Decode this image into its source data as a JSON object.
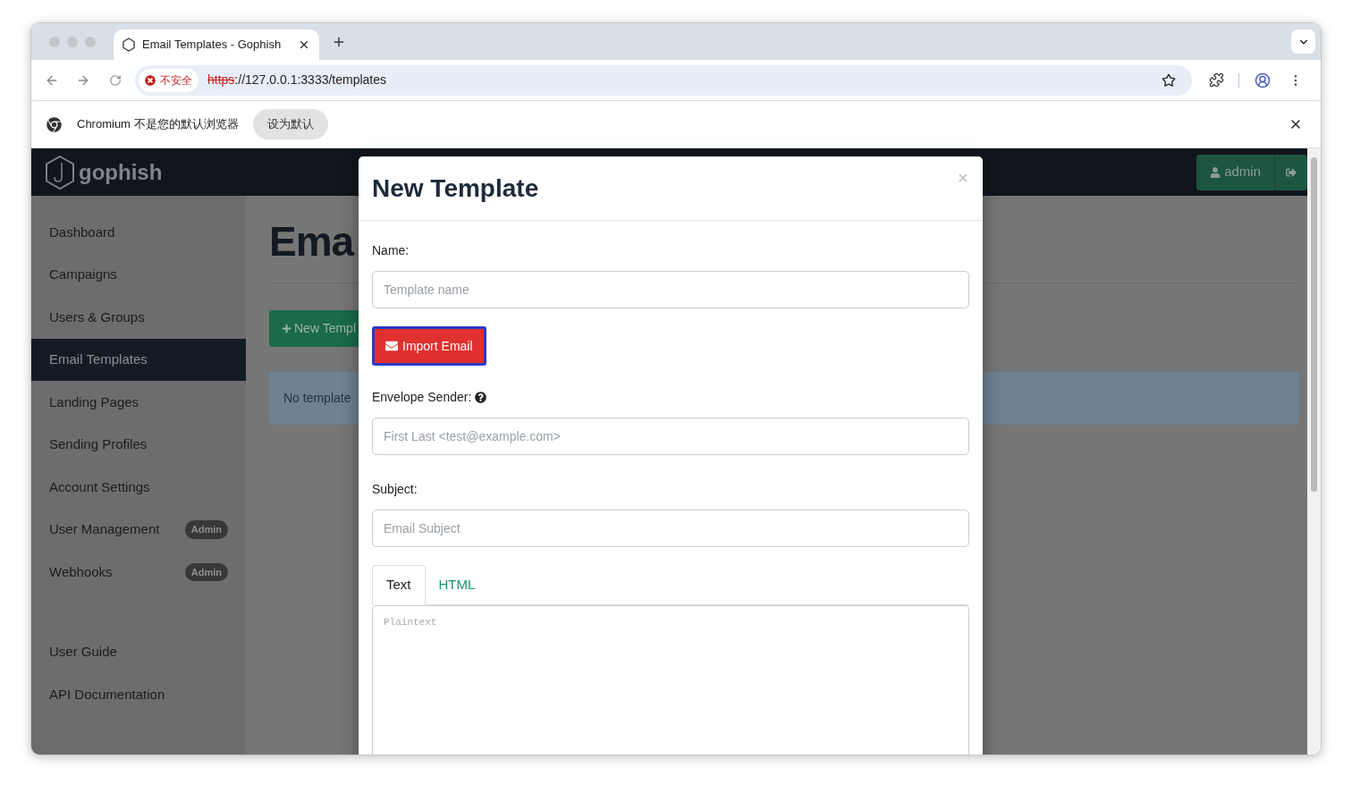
{
  "browser": {
    "tabs": [
      {
        "title": "Email Templates - Gophish",
        "selected": true
      }
    ],
    "security_label": "不安全",
    "url_scheme": "https",
    "url_rest": "://127.0.0.1:3333/templates",
    "infobar": {
      "message": "Chromium 不是您的默认浏览器",
      "button": "设为默认"
    }
  },
  "app": {
    "brand": "gophish",
    "user_button": "admin",
    "nav_items": [
      {
        "label": "Dashboard",
        "selected": false
      },
      {
        "label": "Campaigns",
        "selected": false
      },
      {
        "label": "Users & Groups",
        "selected": false
      },
      {
        "label": "Email Templates",
        "selected": true
      },
      {
        "label": "Landing Pages",
        "selected": false
      },
      {
        "label": "Sending Profiles",
        "selected": false
      },
      {
        "label": "Account Settings",
        "selected": false
      },
      {
        "label": "User Management",
        "selected": false,
        "badge": "Admin"
      },
      {
        "label": "Webhooks",
        "selected": false,
        "badge": "Admin"
      }
    ],
    "help_links": [
      "User Guide",
      "API Documentation"
    ],
    "page": {
      "heading": "Ema",
      "new_button": "New Templ",
      "alert": "No template"
    }
  },
  "modal": {
    "title": "New Template",
    "name": {
      "label": "Name:",
      "placeholder": "Template name"
    },
    "import_button": "Import Email",
    "envelope_sender": {
      "label": "Envelope Sender:",
      "placeholder": "First Last <test@example.com>",
      "help": true
    },
    "subject": {
      "label": "Subject:",
      "placeholder": "Email Subject"
    },
    "editor_tabs": [
      {
        "label": "Text",
        "selected": true
      },
      {
        "label": "HTML",
        "selected": false
      }
    ],
    "editor_placeholder": "Plaintext"
  }
}
